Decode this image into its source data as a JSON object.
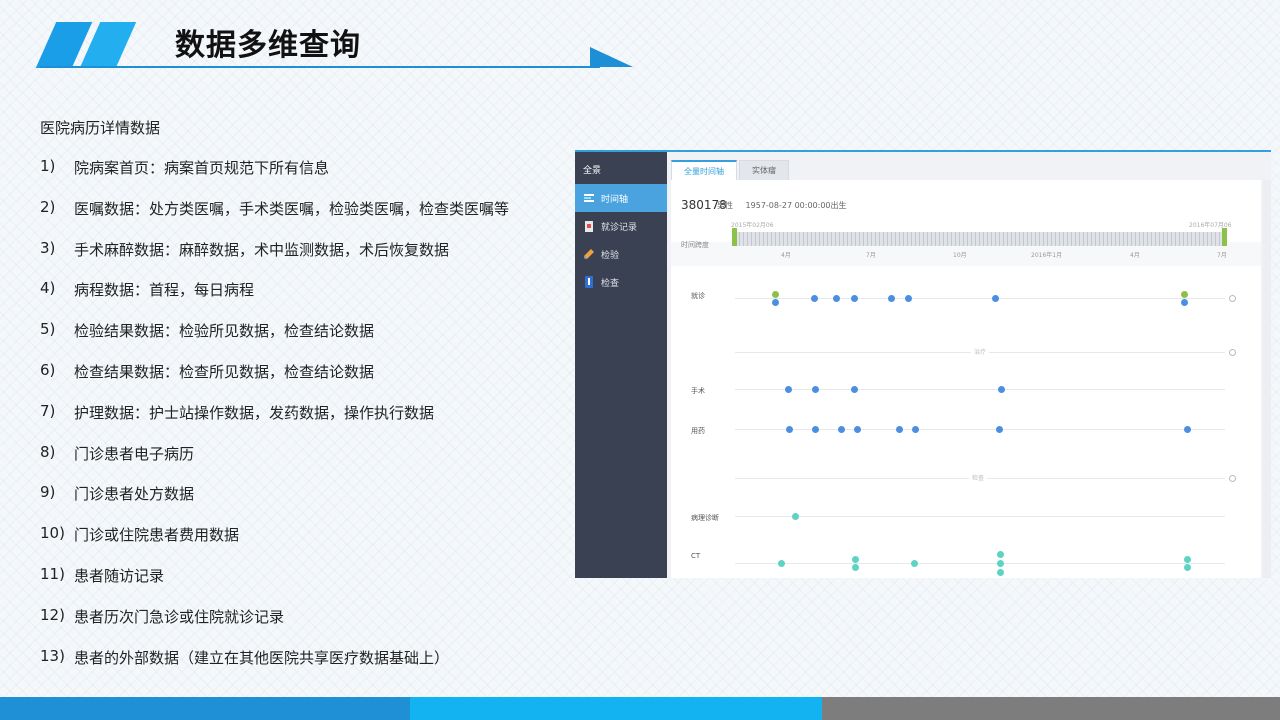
{
  "header": {
    "title": "数据多维查询",
    "accent_color": "#1c8fd6"
  },
  "intro": "医院病历详情数据",
  "items": [
    {
      "num": "1)",
      "text": "院病案首页：病案首页规范下所有信息"
    },
    {
      "num": "2)",
      "text": "医嘱数据：处方类医嘱，手术类医嘱，检验类医嘱，检查类医嘱等"
    },
    {
      "num": "3)",
      "text": "手术麻醉数据：麻醉数据，术中监测数据，术后恢复数据"
    },
    {
      "num": "4)",
      "text": "病程数据：首程，每日病程"
    },
    {
      "num": "5)",
      "text": "检验结果数据：检验所见数据，检查结论数据"
    },
    {
      "num": "6)",
      "text": "检查结果数据：检查所见数据，检查结论数据"
    },
    {
      "num": "7)",
      "text": "护理数据：护士站操作数据，发药数据，操作执行数据"
    },
    {
      "num": "8)",
      "text": "门诊患者电子病历"
    },
    {
      "num": "9)",
      "text": "门诊患者处方数据"
    },
    {
      "num": "10)",
      "text": "门诊或住院患者费用数据"
    },
    {
      "num": "11)",
      "text": "患者随访记录"
    },
    {
      "num": "12)",
      "text": "患者历次门急诊或住院就诊记录"
    },
    {
      "num": "13)",
      "text": "患者的外部数据（建立在其他医院共享医疗数据基础上）"
    }
  ],
  "screenshot": {
    "sidebar": {
      "header": "全景",
      "items": [
        {
          "label": "时间轴",
          "icon": "timeline-icon",
          "active": true
        },
        {
          "label": "就诊记录",
          "icon": "record-icon",
          "active": false
        },
        {
          "label": "检验",
          "icon": "test-tube-icon",
          "active": false
        },
        {
          "label": "检查",
          "icon": "exam-icon",
          "active": false
        }
      ]
    },
    "tabs": [
      {
        "label": "全量时间轴",
        "active": true
      },
      {
        "label": "实体瘤",
        "active": false
      }
    ],
    "patient": {
      "id": "380178",
      "gender": "男性",
      "birth": "1957-08-27 00:00:00出生"
    },
    "ruler": {
      "label": "时间跨度",
      "start": "2015年02月06",
      "end": "2016年07月06",
      "ticks": [
        "4月",
        "7月",
        "10月",
        "2016年1月",
        "4月",
        "7月"
      ]
    },
    "rows": {
      "visit": "就诊",
      "treatment": "治疗",
      "surgery": "手术",
      "medication": "用药",
      "inspection": "检查",
      "pathology": "病理诊断",
      "ct": "CT"
    }
  }
}
